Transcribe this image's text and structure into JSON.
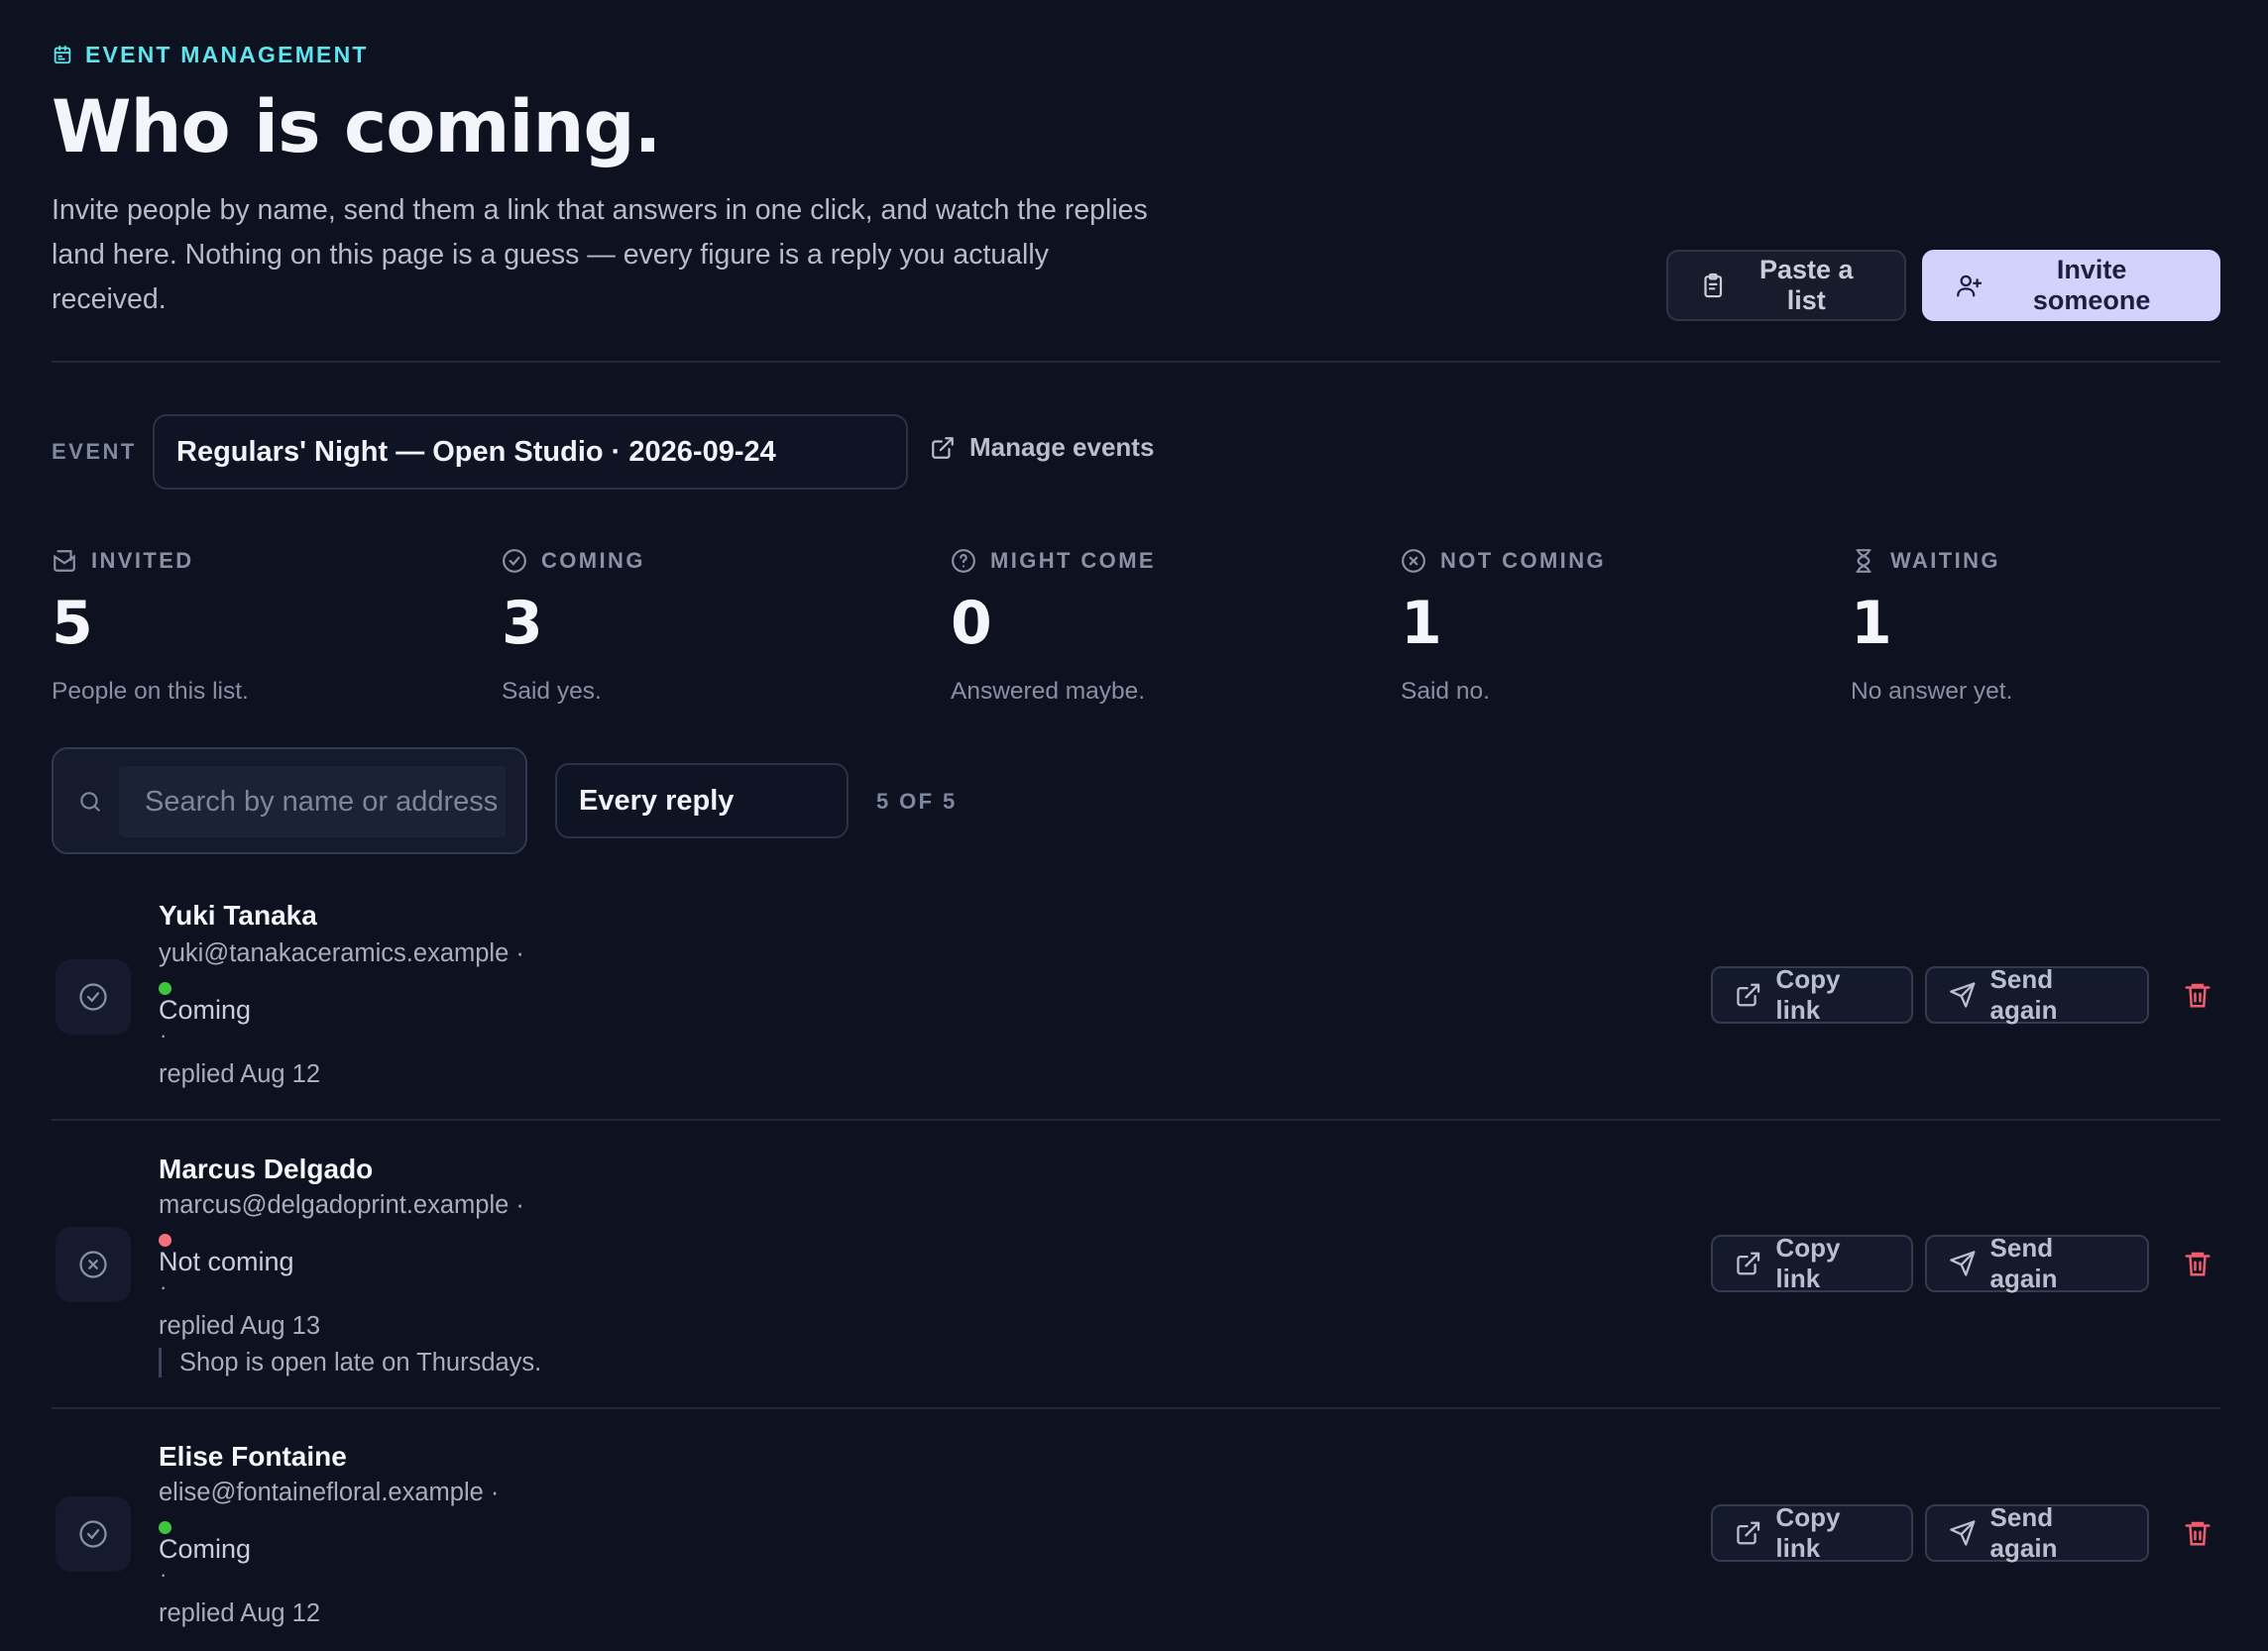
{
  "header": {
    "eyebrow": "EVENT MANAGEMENT",
    "title": "Who is coming.",
    "description": "Invite people by name, send them a link that answers in one click, and watch the replies land here. Nothing on this page is a guess — every figure is a reply you actually received.",
    "paste_label": "Paste a list",
    "invite_label": "Invite someone"
  },
  "event": {
    "label": "EVENT",
    "selected": "Regulars' Night — Open Studio · 2026-09-24",
    "manage_label": "Manage events"
  },
  "stats": [
    {
      "label": "INVITED",
      "value": "5",
      "sub": "People on this list.",
      "icon": "envelope-icon"
    },
    {
      "label": "COMING",
      "value": "3",
      "sub": "Said yes.",
      "icon": "check-circle-icon"
    },
    {
      "label": "MIGHT COME",
      "value": "0",
      "sub": "Answered maybe.",
      "icon": "question-circle-icon"
    },
    {
      "label": "NOT COMING",
      "value": "1",
      "sub": "Said no.",
      "icon": "x-circle-icon"
    },
    {
      "label": "WAITING",
      "value": "1",
      "sub": "No answer yet.",
      "icon": "hourglass-icon"
    }
  ],
  "filters": {
    "search_placeholder": "Search by name or address",
    "reply_filter": "Every reply",
    "count": "5 OF 5"
  },
  "guests": [
    {
      "name": "Yuki Tanaka",
      "email": "yuki@tanakaceramics.example ·",
      "status": "Coming",
      "sep": "·",
      "replied": "replied Aug 12",
      "note": ""
    },
    {
      "name": "Marcus Delgado",
      "email": "marcus@delgadoprint.example ·",
      "status": "Not coming",
      "sep": "·",
      "replied": "replied Aug 13",
      "note": "Shop is open late on Thursdays."
    },
    {
      "name": "Elise Fontaine",
      "email": "elise@fontainefloral.example ·",
      "status": "Coming",
      "sep": "·",
      "replied": "replied Aug 12",
      "note": ""
    }
  ],
  "row_actions": {
    "copy_label": "Copy link",
    "send_label": "Send again"
  },
  "colors": {
    "accent": "#5fe3ec",
    "primary_button": "#d3d2fd",
    "status_coming": "#3fc43f",
    "status_not_coming": "#f4707c",
    "delete": "#f25d6b"
  }
}
